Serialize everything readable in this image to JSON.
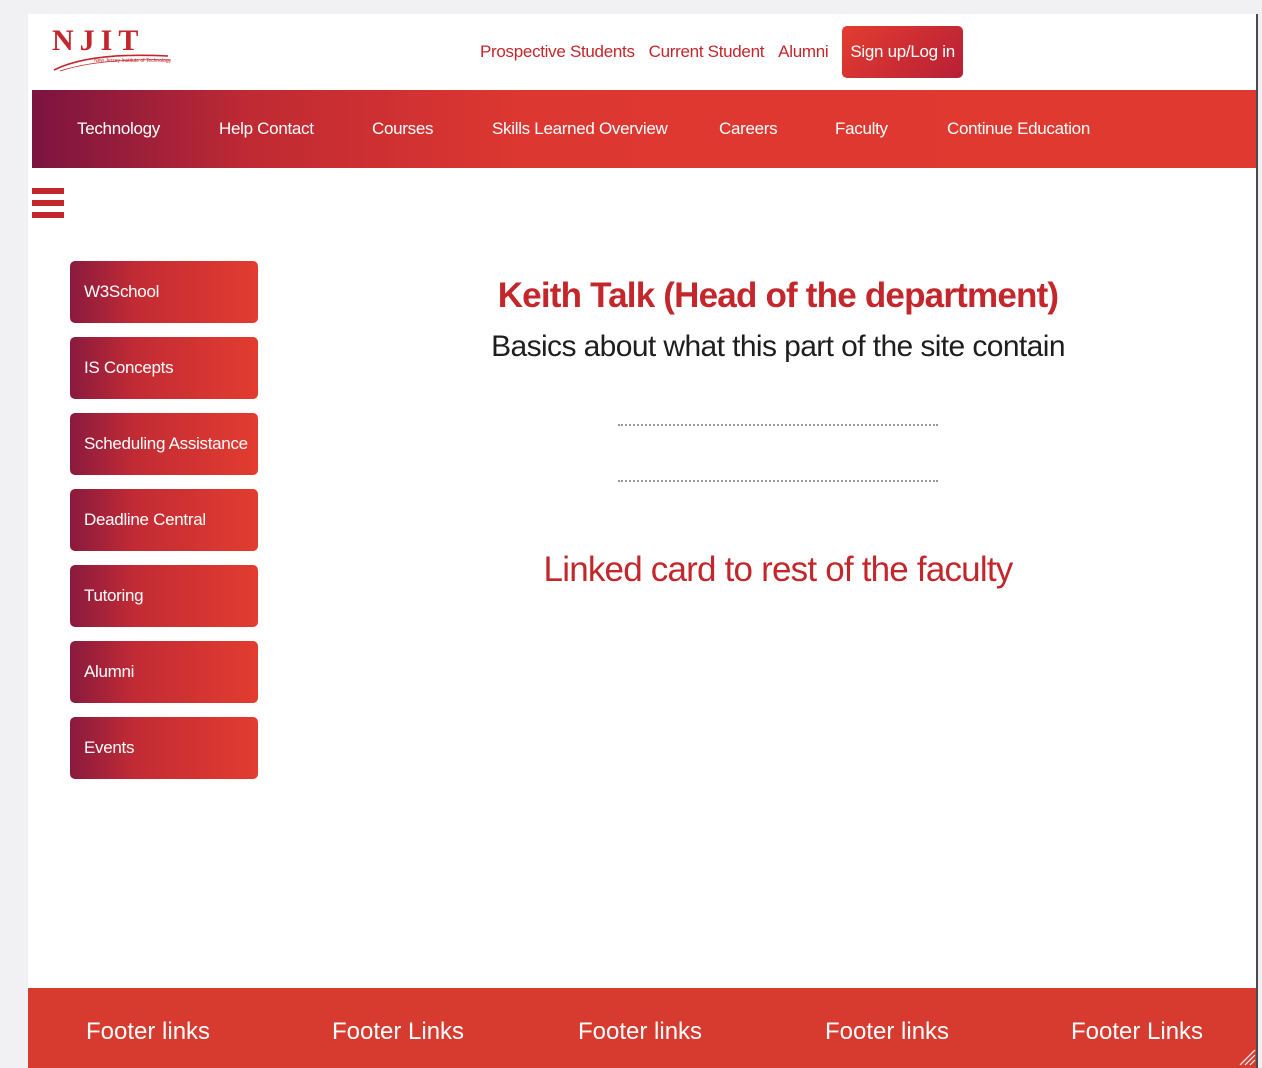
{
  "logo": {
    "letters": "NJIT",
    "subtitle": "New Jersey Institute of Technology",
    "icon": "njit-logo-icon"
  },
  "top_links": {
    "prospective": "Prospective Students",
    "current": "Current Student",
    "alumni": "Alumni",
    "signup": "Sign up/Log in"
  },
  "nav": {
    "items": [
      "Technology",
      "Help Contact",
      "Courses",
      "Skills Learned Overview",
      "Careers",
      "Faculty",
      "Continue Education"
    ]
  },
  "menu_icon": "hamburger-menu-icon",
  "sidebar": {
    "items": [
      "W3School",
      "IS Concepts",
      "Scheduling Assistance",
      "Deadline Central",
      "Tutoring",
      "Alumni",
      "Events"
    ]
  },
  "main": {
    "title": "Keith Talk (Head of the department)",
    "subtitle": "Basics about what this part of the site contain",
    "linked_card": "Linked card to rest of the faculty"
  },
  "footer": {
    "links": [
      "Footer links",
      "Footer Links",
      "Footer links",
      "Footer links",
      "Footer Links"
    ]
  },
  "colors": {
    "brand_red": "#c3262b",
    "nav_gradient_start": "#7b1440",
    "nav_gradient_end": "#e03a30",
    "footer_red": "#d73a2f"
  }
}
